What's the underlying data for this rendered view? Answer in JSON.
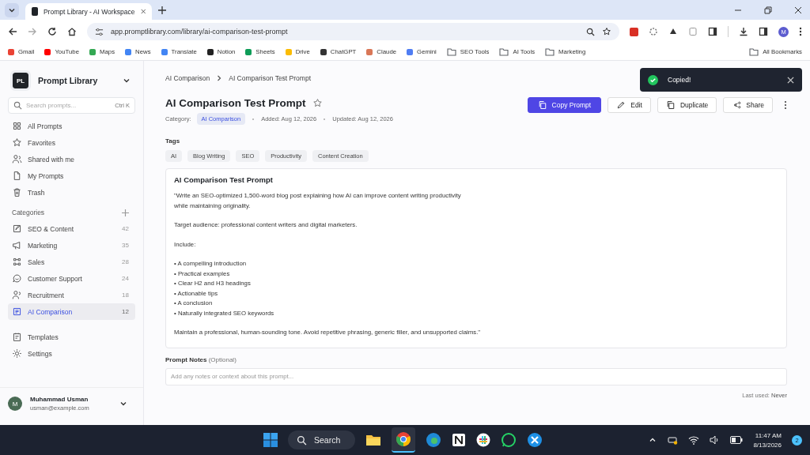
{
  "browser": {
    "tab_title": "Prompt Library - AI Workspace",
    "url": "app.promptlibrary.com/library/ai-comparison-test-prompt",
    "profile_initial": "M",
    "bookmarks": [
      {
        "label": "Gmail",
        "kind": "site",
        "color": "#ea4335"
      },
      {
        "label": "YouTube",
        "kind": "site",
        "color": "#ff0000"
      },
      {
        "label": "Maps",
        "kind": "site",
        "color": "#34a853"
      },
      {
        "label": "News",
        "kind": "site",
        "color": "#4285f4"
      },
      {
        "label": "Translate",
        "kind": "site",
        "color": "#4285f4"
      },
      {
        "label": "Notion",
        "kind": "site",
        "color": "#222222"
      },
      {
        "label": "Sheets",
        "kind": "site",
        "color": "#0f9d58"
      },
      {
        "label": "Drive",
        "kind": "site",
        "color": "#fbbc04"
      },
      {
        "label": "ChatGPT",
        "kind": "site",
        "color": "#333333"
      },
      {
        "label": "Claude",
        "kind": "site",
        "color": "#d97757"
      },
      {
        "label": "Gemini",
        "kind": "site",
        "color": "#4f7df3"
      },
      {
        "label": "SEO Tools",
        "kind": "folder"
      },
      {
        "label": "AI Tools",
        "kind": "folder"
      },
      {
        "label": "Marketing",
        "kind": "folder"
      }
    ],
    "all_bookmarks": "All Bookmarks"
  },
  "sidebar": {
    "app_name": "Prompt Library",
    "logo_text": "PL",
    "search": {
      "placeholder": "Search prompts...",
      "shortcut": "Ctrl K"
    },
    "nav": [
      {
        "label": "All Prompts"
      },
      {
        "label": "Favorites"
      },
      {
        "label": "Shared with me"
      },
      {
        "label": "My Prompts"
      },
      {
        "label": "Trash"
      }
    ],
    "categories_heading": "Categories",
    "categories": [
      {
        "label": "SEO & Content",
        "count": "42",
        "selected": false
      },
      {
        "label": "Marketing",
        "count": "35",
        "selected": false
      },
      {
        "label": "Sales",
        "count": "28",
        "selected": false
      },
      {
        "label": "Customer Support",
        "count": "24",
        "selected": false
      },
      {
        "label": "Recruitment",
        "count": "18",
        "selected": false
      },
      {
        "label": "AI Comparison",
        "count": "12",
        "selected": true
      }
    ],
    "bottom": [
      {
        "label": "Templates"
      },
      {
        "label": "Settings"
      }
    ],
    "user": {
      "initial": "M",
      "name": "Muhammad Usman",
      "email": "usman@example.com"
    }
  },
  "main": {
    "breadcrumb": [
      "AI Comparison",
      "AI Comparison Test Prompt"
    ],
    "title": "AI Comparison Test Prompt",
    "favorite": false,
    "category_label": "Category:",
    "category": "AI Comparison",
    "added": "Added: Aug 12, 2026",
    "updated": "Updated: Aug 12, 2026",
    "buttons": [
      {
        "label": "Copy Prompt",
        "kind": "primary"
      },
      {
        "label": "Edit",
        "kind": "edit"
      },
      {
        "label": "Duplicate",
        "kind": "duplicate"
      },
      {
        "label": "Share",
        "kind": "share"
      }
    ],
    "tags_heading": "Tags",
    "tags": [
      "AI",
      "Blog Writing",
      "SEO",
      "Productivity",
      "Content Creation"
    ],
    "prompt": {
      "title": "AI Comparison Test Prompt",
      "paragraphs": [
        "\"Write an SEO-optimized 1,500-word blog post explaining how AI can improve content writing productivity\nwhile maintaining originality.",
        "Target audience: professional content writers and digital marketers.",
        "Include:"
      ],
      "bullets": [
        "• A compelling introduction",
        "• Practical examples",
        "• Clear H2 and H3 headings",
        "• Actionable tips",
        "• A conclusion",
        "• Naturally integrated SEO keywords"
      ],
      "closing": "Maintain a professional, human-sounding tone. Avoid repetitive phrasing, generic filler, and unsupported claims.\""
    },
    "notes": {
      "label": "Prompt Notes",
      "optional": "(Optional)",
      "placeholder": "Add any notes or context about this prompt..."
    },
    "last_used_label": "Last used:",
    "last_used": "Never"
  },
  "toast": {
    "message": "Copied!"
  },
  "taskbar": {
    "search": "Search",
    "time": "11:47 AM",
    "date": "8/13/2026",
    "notifications": "2"
  }
}
